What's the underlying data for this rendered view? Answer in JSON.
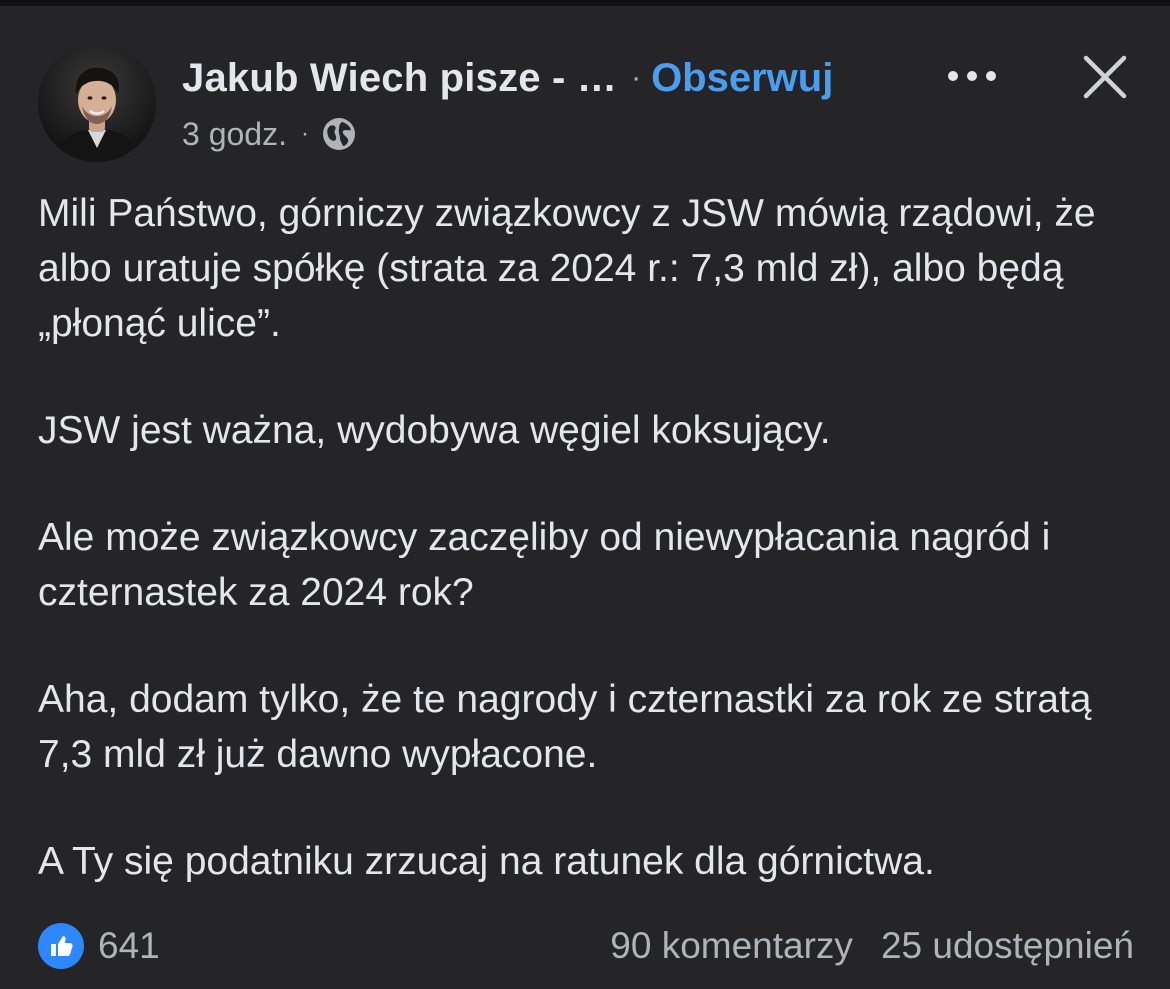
{
  "post": {
    "author": "Jakub Wiech pisze - …",
    "separator": "·",
    "follow_label": "Obserwuj",
    "time": "3 godz.",
    "meta_separator": "·",
    "paragraphs": [
      "Mili Państwo, górniczy związkowcy z JSW mówią rządowi, że albo uratuje spółkę (strata za 2024 r.: 7,3 mld zł), albo będą „płonąć ulice”.",
      "JSW jest ważna, wydobywa węgiel koksujący.",
      "Ale może związkowcy zaczęliby od niewypłacania nagród i czternastek za 2024 rok?",
      "Aha, dodam tylko, że te nagrody i czternastki za rok ze stratą 7,3 mld zł już dawno wypłacone.",
      "A Ty się podatniku zrzucaj na ratunek dla górnictwa."
    ],
    "reactions_count": "641",
    "comments_label": "90 komentarzy",
    "shares_label": "25 udostępnień"
  },
  "icons": {
    "more": "more-horizontal-icon",
    "close": "close-icon",
    "privacy": "globe-icon",
    "reaction": "like-icon"
  },
  "colors": {
    "background": "#252527",
    "text": "#e4e6eb",
    "secondary_text": "#b0b3b8",
    "follow": "#4a9df0",
    "like_badge": "#2d88ff"
  }
}
